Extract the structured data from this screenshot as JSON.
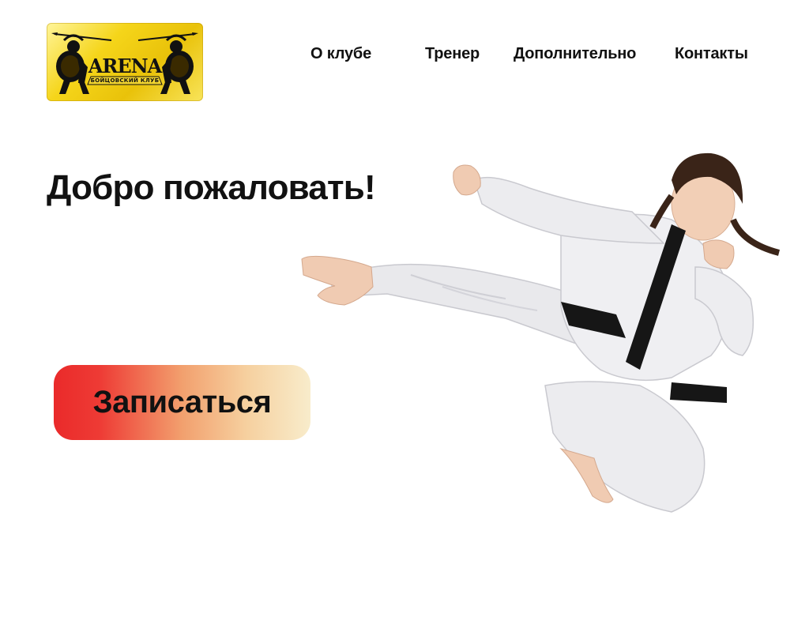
{
  "logo": {
    "word": "ARENA",
    "subtitle": "БОЙЦОВСКИЙ КЛУБ"
  },
  "nav": {
    "items": [
      {
        "label": "О клубе"
      },
      {
        "label": "Тренер"
      },
      {
        "label": "Дополнительно"
      },
      {
        "label": "Контакты"
      }
    ]
  },
  "hero": {
    "title": "Добро пожаловать!",
    "cta_label": "Записаться"
  },
  "colors": {
    "logo_bg": "#f5d51a",
    "cta_gradient_start": "#ea2a2a",
    "cta_gradient_end": "#f8eccb",
    "text": "#111111",
    "background": "#ffffff"
  },
  "images": {
    "logo_figures": "two-warriors-with-spears",
    "hero_photo": "woman-martial-artist-flying-kick-white-gi-black-belt"
  }
}
